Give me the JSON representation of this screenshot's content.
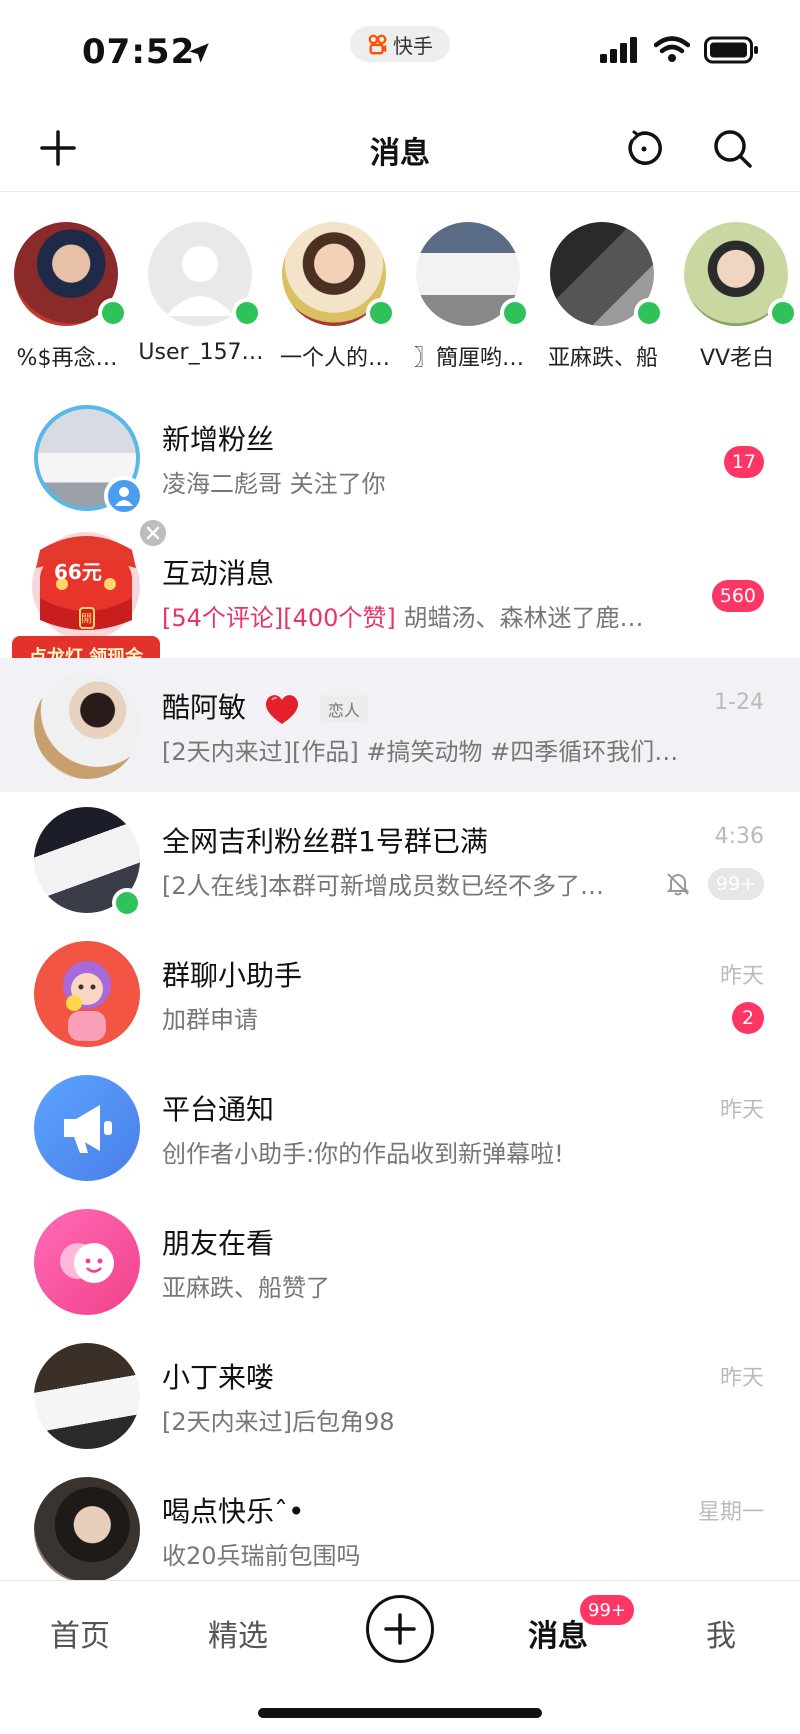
{
  "status_bar": {
    "time": "07:52",
    "app_name": "快手"
  },
  "header": {
    "title": "消息"
  },
  "stories": [
    {
      "name": "%$再念…"
    },
    {
      "name": "User_157…"
    },
    {
      "name": "一个人的…"
    },
    {
      "name": "〗簡厘哟…"
    },
    {
      "name": "亚麻跌、船"
    },
    {
      "name": "VV老白"
    }
  ],
  "messages": [
    {
      "title": "新增粉丝",
      "subtitle": "凌海二彪哥 关注了你",
      "time": "",
      "badge": "17"
    },
    {
      "title": "互动消息",
      "subtitle_highlight": "[54个评论][400个赞]",
      "subtitle": " 胡蜡汤、森林迷了鹿…",
      "time": "",
      "badge": "560"
    },
    {
      "title": "酷阿敏",
      "tag": "恋人",
      "subtitle": "[2天内来过][作品] #搞笑动物 #四季循环我们…",
      "time": "1-24",
      "badge": ""
    },
    {
      "title": "全网吉利粉丝群1号群已满",
      "subtitle": "[2人在线]本群可新增成员数已经不多了…",
      "time": "4:36",
      "badge": "99+"
    },
    {
      "title": "群聊小助手",
      "subtitle": "加群申请",
      "time": "昨天",
      "badge": "2"
    },
    {
      "title": "平台通知",
      "subtitle": "创作者小助手:你的作品收到新弹幕啦!",
      "time": "昨天",
      "badge": ""
    },
    {
      "title": "朋友在看",
      "subtitle": "亚麻跌、船赞了",
      "time": "",
      "badge": ""
    },
    {
      "title": "小丁来喽",
      "subtitle": "[2天内来过]后包角98",
      "time": "昨天",
      "badge": ""
    },
    {
      "title": "喝点快乐ˆ•",
      "subtitle": "收20兵瑞前包围吗",
      "time": "星期一",
      "badge": ""
    }
  ],
  "promo": {
    "amount": "66元",
    "label": "点龙灯 领现金",
    "lantern_text": "開"
  },
  "tabbar": {
    "home": "首页",
    "featured": "精选",
    "messages": "消息",
    "messages_badge": "99+",
    "me": "我"
  },
  "colors": {
    "accent_pink": "#fe3666",
    "online_green": "#2fc25b",
    "notify_blue": "#4a8cf7",
    "friends_pink": "#f84d9a"
  }
}
